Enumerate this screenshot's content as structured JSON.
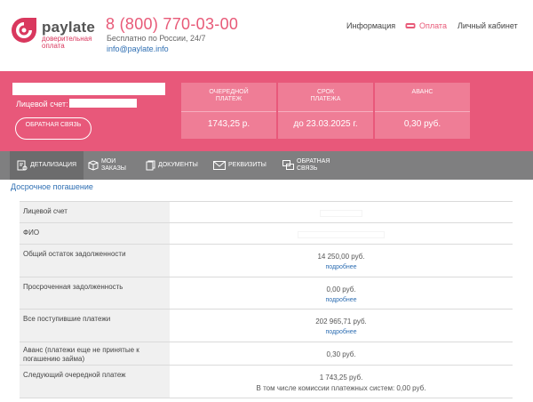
{
  "header": {
    "logo_name": "paylate",
    "logo_sub": "доверительная оплата",
    "phone": "8 (800) 770-03-00",
    "free_call": "Бесплатно по России, 24/7",
    "email": "info@paylate.info",
    "nav": {
      "info": "Информация",
      "pay": "Оплата",
      "cabinet": "Личный кабинет"
    }
  },
  "account": {
    "label": "Лицевой счет:",
    "feedback_button": "Обратная связь"
  },
  "cards": [
    {
      "title": "Очередной платеж",
      "value": "1743,25 р."
    },
    {
      "title": "Срок платежа",
      "value": "до 23.03.2025 г."
    },
    {
      "title": "Аванс",
      "value": "0,30 руб."
    }
  ],
  "tabs": [
    {
      "label": "Детализация",
      "icon": "document-search-icon"
    },
    {
      "label": "Мои заказы",
      "icon": "box-icon"
    },
    {
      "label": "Документы",
      "icon": "documents-icon"
    },
    {
      "label": "Реквизиты",
      "icon": "envelope-icon"
    },
    {
      "label": "Обратная связь",
      "icon": "chat-bubbles-icon"
    }
  ],
  "early_repayment_link": "Досрочное погашение",
  "table": {
    "rows": [
      {
        "label": "Лицевой счет",
        "value": "",
        "more": ""
      },
      {
        "label": "ФИО",
        "value": "",
        "more": ""
      },
      {
        "label": "Общий остаток задолженности",
        "value": "14 250,00 руб.",
        "more": "подробнее"
      },
      {
        "label": "Просроченная задолженность",
        "value": "0,00 руб.",
        "more": "подробнее"
      },
      {
        "label": "Все поступившие платежи",
        "value": "202 965,71 руб.",
        "more": "подробнее"
      },
      {
        "label": "Аванс (платежи еще не принятые к погашению займа)",
        "value": "0,30 руб.",
        "more": ""
      },
      {
        "label": "Следующий очередной платеж",
        "value": "1 743,25 руб.",
        "more": "",
        "note": "В том числе комиссии платежных систем: 0,00 руб."
      }
    ]
  },
  "colors": {
    "brand_pink": "#e8587a",
    "card_pink": "#ef7d96",
    "tab_grey": "#7f7f80",
    "link_blue": "#2f6fb3"
  }
}
